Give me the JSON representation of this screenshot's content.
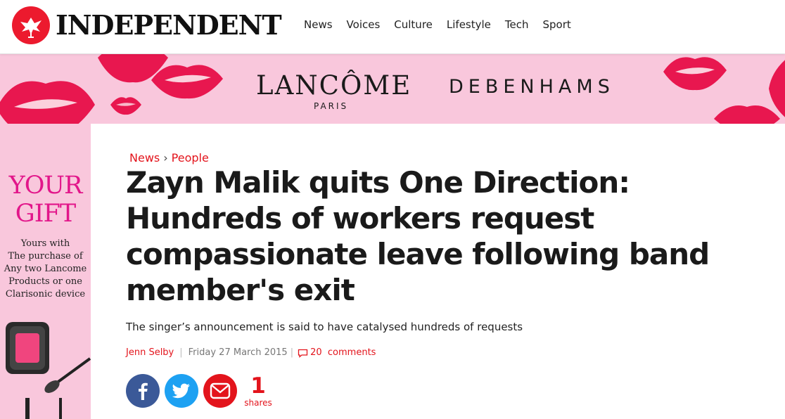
{
  "header": {
    "logo_text": "INDEPENDENT",
    "logo_icon": "eagle-icon",
    "nav": [
      "News",
      "Voices",
      "Culture",
      "Lifestyle",
      "Tech",
      "Sport"
    ]
  },
  "ad": {
    "brand1": "LANCÔME",
    "brand1_sub": "PARIS",
    "brand2": "DEBENHAMS",
    "gift_title_1": "YOUR",
    "gift_title_2": "GIFT",
    "gift_copy": [
      "Yours with",
      "The purchase of",
      "Any two Lancome",
      "Products or one",
      "Clarisonic device"
    ]
  },
  "article": {
    "breadcrumb": [
      "News",
      "People"
    ],
    "headline": "Zayn Malik quits One Direction: Hundreds of workers request compassionate leave following band member's exit",
    "standfirst": "The singer’s announcement is said to have catalysed hundreds of requests",
    "author": "Jenn Selby",
    "date": "Friday 27 March 2015",
    "comments_count": "20",
    "comments_label": "comments",
    "shares_count": "1",
    "shares_label": "shares"
  },
  "colors": {
    "brand_red": "#e3141c",
    "ad_pink": "#f9c7dc",
    "facebook": "#3b5998",
    "twitter": "#1da1f2"
  }
}
